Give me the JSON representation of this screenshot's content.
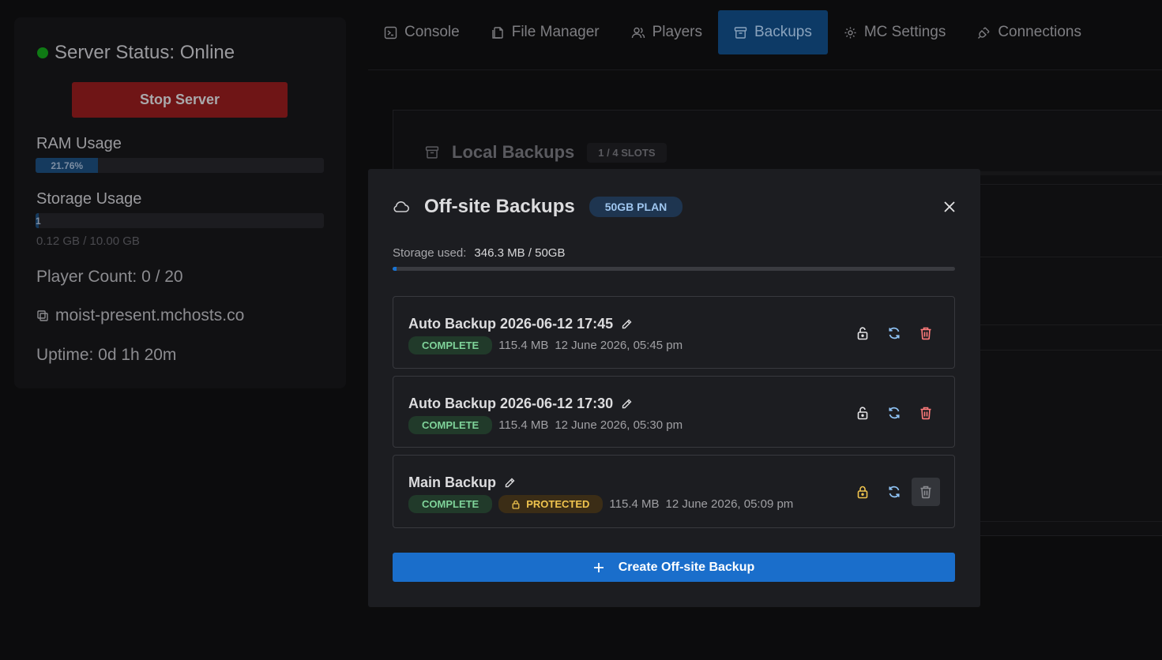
{
  "sidebar": {
    "status": "Server Status: Online",
    "stop_label": "Stop Server",
    "ram_label": "RAM Usage",
    "ram_percent": "21.76%",
    "ram_fraction": 0.2176,
    "storage_label": "Storage Usage",
    "storage_bar_text": "1",
    "storage_fraction": 0.012,
    "storage_amount": "0.12 GB / 10.00 GB",
    "player_count": "Player Count: 0 / 20",
    "domain": "moist-present.mchosts.co",
    "uptime": "Uptime: 0d 1h 20m"
  },
  "tabs": [
    {
      "label": "Console",
      "icon": "terminal-icon"
    },
    {
      "label": "File Manager",
      "icon": "files-icon"
    },
    {
      "label": "Players",
      "icon": "users-icon"
    },
    {
      "label": "Backups",
      "icon": "archive-icon",
      "active": true
    },
    {
      "label": "MC Settings",
      "icon": "gear-icon"
    },
    {
      "label": "Connections",
      "icon": "plug-icon"
    }
  ],
  "local": {
    "title": "Local Backups",
    "slots": "1 / 4 SLOTS"
  },
  "modal": {
    "title": "Off-site Backups",
    "plan": "50GB PLAN",
    "storage_label": "Storage used:",
    "storage_value": "346.3 MB / 50GB",
    "storage_fraction": 0.0069,
    "backups": [
      {
        "name": "Auto Backup 2026-06-12 17:45",
        "status": "COMPLETE",
        "size": "115.4 MB",
        "date": "12 June 2026, 05:45 pm",
        "protected": false
      },
      {
        "name": "Auto Backup 2026-06-12 17:30",
        "status": "COMPLETE",
        "size": "115.4 MB",
        "date": "12 June 2026, 05:30 pm",
        "protected": false
      },
      {
        "name": "Main Backup",
        "status": "COMPLETE",
        "protected_label": "PROTECTED",
        "size": "115.4 MB",
        "date": "12 June 2026, 05:09 pm",
        "protected": true
      }
    ],
    "create_label": "Create Off-site Backup"
  },
  "colors": {
    "accent": "#1a6ecb",
    "danger": "#ff6b6b",
    "complete": "#7fd39a",
    "protected": "#f0c44e",
    "online": "#0f7a14"
  }
}
